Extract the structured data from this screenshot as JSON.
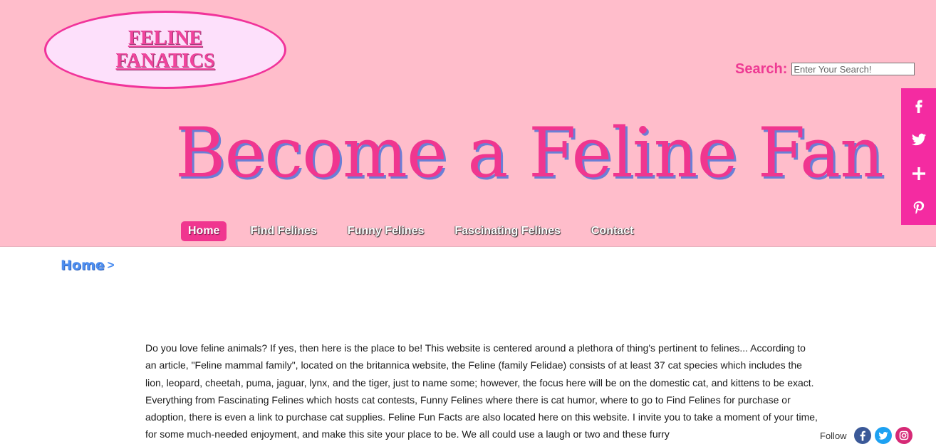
{
  "logo": {
    "line1": "FELINE",
    "line2": "FANATICS"
  },
  "search": {
    "label": "Search:",
    "placeholder": "Enter Your Search!"
  },
  "hero": {
    "title": "Become a Feline Fan"
  },
  "nav": {
    "items": [
      {
        "label": "Home",
        "active": true
      },
      {
        "label": "Find Felines"
      },
      {
        "label": "Funny Felines"
      },
      {
        "label": "Fascinating Felines"
      },
      {
        "label": "Contact"
      }
    ]
  },
  "share": {
    "icons": [
      "facebook-icon",
      "twitter-icon",
      "plus-icon",
      "pinterest-icon"
    ]
  },
  "breadcrumb": {
    "home": "Home",
    "separator": ">"
  },
  "content": {
    "paragraph": "Do you love feline animals? If yes, then here is the place to be! This website is centered around a plethora of thing's pertinent to felines... According to an article, \"Feline mammal family\", located on the britannica website, the Feline (family Felidae) consists of at least 37 cat species which includes the lion, leopard, cheetah, puma, jaguar, lynx, and the tiger, just to name some; however, the focus here will be on the domestic cat, and kittens to be exact. Everything from Fascinating Felines which hosts cat contests, Funny Felines where there is cat humor, where to go to Find Felines for purchase or adoption, there is even a link to purchase cat supplies. Feline Fun Facts are also located here on this website. I invite you to take a moment of your time, for some much-needed enjoyment, and make this site your place to be. We all could use a laugh or two and these furry"
  },
  "follow": {
    "label": "Follow"
  },
  "colors": {
    "header_bg": "#ffbdcb",
    "accent": "#f0368f",
    "share_bar": "#f42ba1",
    "breadcrumb": "#4d8ef0"
  }
}
